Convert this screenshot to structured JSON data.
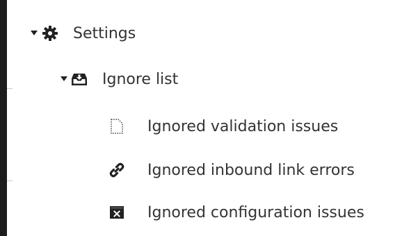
{
  "tree": {
    "settings": {
      "label": "Settings",
      "icon": "gear-icon",
      "expanded": true,
      "children": {
        "ignore_list": {
          "label": "Ignore list",
          "icon": "inbox-download-icon",
          "expanded": true,
          "children": [
            {
              "label": "Ignored validation issues",
              "icon": "dashed-document-icon"
            },
            {
              "label": "Ignored inbound link errors",
              "icon": "link-icon"
            },
            {
              "label": "Ignored configuration issues",
              "icon": "close-window-icon"
            }
          ]
        }
      }
    }
  },
  "colors": {
    "text": "#333333",
    "icon": "#222222",
    "left_bar": "#1c1c1c",
    "background": "#ffffff"
  }
}
